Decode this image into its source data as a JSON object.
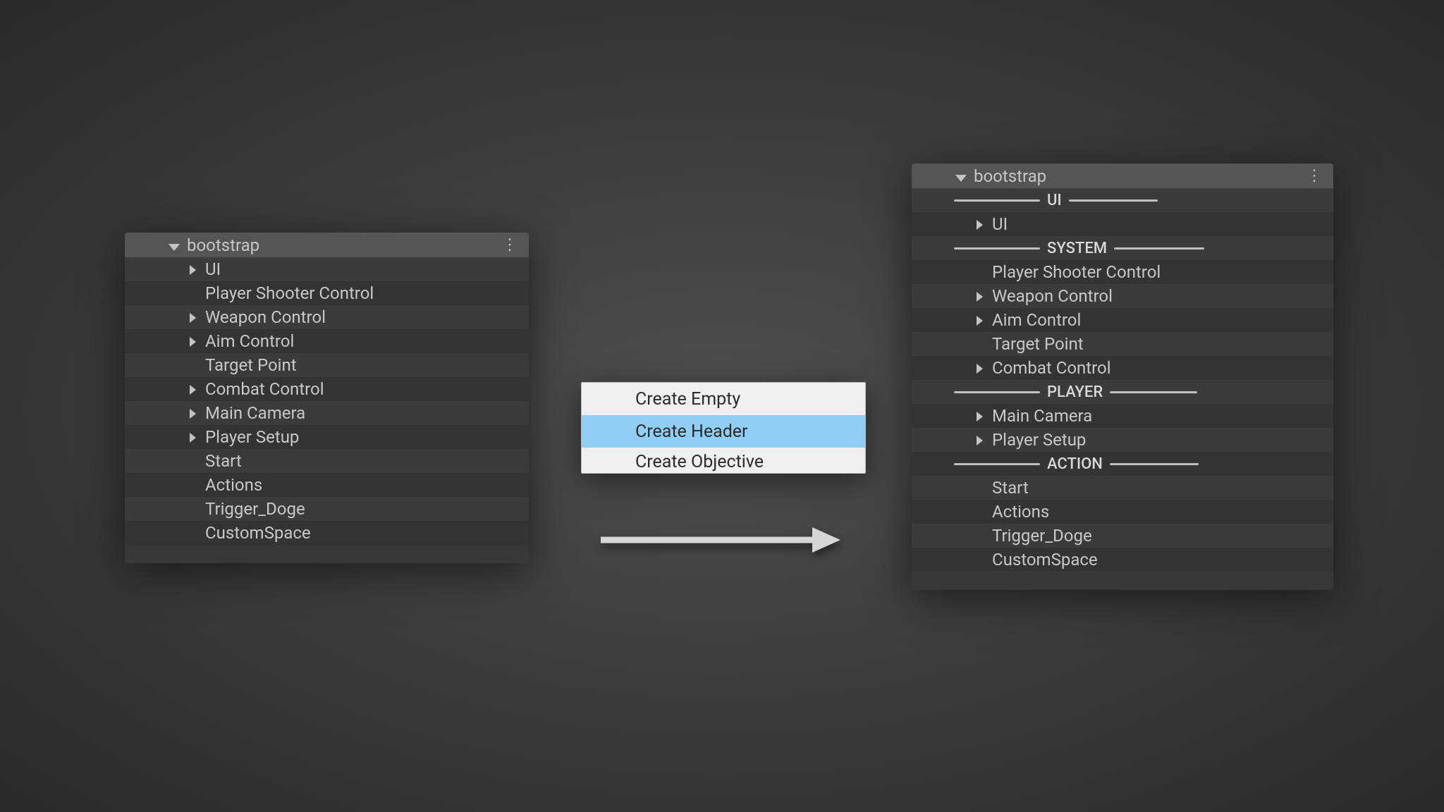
{
  "left_panel": {
    "title": "bootstrap",
    "items": [
      {
        "label": "UI",
        "arrow": true
      },
      {
        "label": "Player Shooter Control",
        "arrow": false
      },
      {
        "label": "Weapon Control",
        "arrow": true
      },
      {
        "label": "Aim Control",
        "arrow": true
      },
      {
        "label": "Target Point",
        "arrow": false
      },
      {
        "label": "Combat Control",
        "arrow": true
      },
      {
        "label": "Main Camera",
        "arrow": true
      },
      {
        "label": "Player Setup",
        "arrow": true
      },
      {
        "label": "Start",
        "arrow": false
      },
      {
        "label": "Actions",
        "arrow": false
      },
      {
        "label": "Trigger_Doge",
        "arrow": false
      },
      {
        "label": "CustomSpace",
        "arrow": false
      }
    ]
  },
  "context_menu": {
    "items": [
      {
        "label": "Create Empty",
        "highlighted": false
      },
      {
        "label": "Create Header",
        "highlighted": true
      },
      {
        "label": "Create Objective",
        "highlighted": false
      }
    ]
  },
  "right_panel": {
    "title": "bootstrap",
    "sections": {
      "ui": "UI",
      "system": "SYSTEM",
      "player": "PLAYER",
      "action": "ACTION"
    },
    "items": [
      {
        "kind": "divider",
        "key": "ui"
      },
      {
        "kind": "item",
        "label": "UI",
        "arrow": true
      },
      {
        "kind": "divider",
        "key": "system"
      },
      {
        "kind": "item",
        "label": "Player Shooter Control",
        "arrow": false
      },
      {
        "kind": "item",
        "label": "Weapon Control",
        "arrow": true
      },
      {
        "kind": "item",
        "label": "Aim Control",
        "arrow": true
      },
      {
        "kind": "item",
        "label": "Target Point",
        "arrow": false
      },
      {
        "kind": "item",
        "label": "Combat Control",
        "arrow": true
      },
      {
        "kind": "divider",
        "key": "player"
      },
      {
        "kind": "item",
        "label": "Main Camera",
        "arrow": true
      },
      {
        "kind": "item",
        "label": "Player Setup",
        "arrow": true
      },
      {
        "kind": "divider",
        "key": "action"
      },
      {
        "kind": "item",
        "label": "Start",
        "arrow": false
      },
      {
        "kind": "item",
        "label": "Actions",
        "arrow": false
      },
      {
        "kind": "item",
        "label": "Trigger_Doge",
        "arrow": false
      },
      {
        "kind": "item",
        "label": "CustomSpace",
        "arrow": false
      }
    ]
  }
}
